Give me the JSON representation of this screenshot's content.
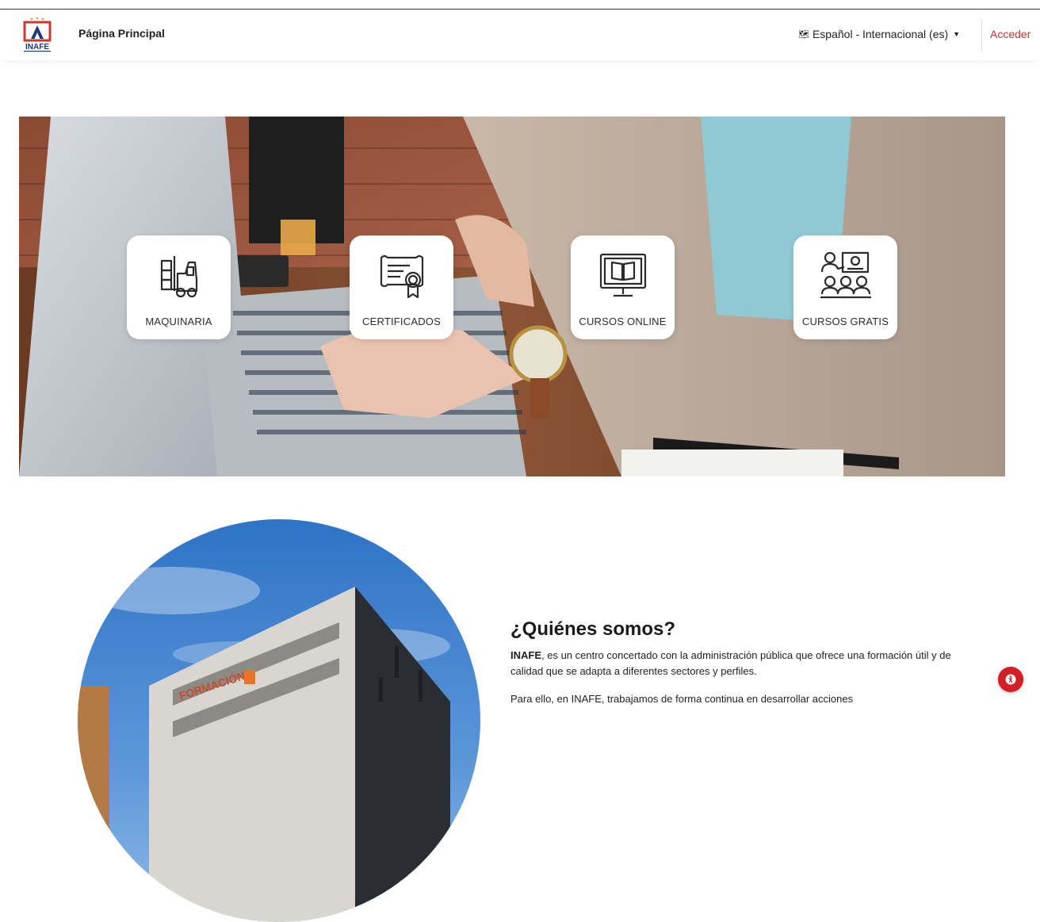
{
  "header": {
    "logo_text": "INAFE",
    "brand": "Página Principal",
    "language": "Español - Internacional (es)",
    "login": "Acceder"
  },
  "hero": {
    "cards": [
      {
        "label": "MAQUINARIA",
        "icon": "forklift-icon"
      },
      {
        "label": "CERTIFICADOS",
        "icon": "certificate-icon"
      },
      {
        "label": "CURSOS ONLINE",
        "icon": "online-course-icon"
      },
      {
        "label": "CURSOS GRATIS",
        "icon": "classroom-icon"
      }
    ]
  },
  "about": {
    "title": "¿Quiénes somos?",
    "p1_strong": "INAFE",
    "p1_rest": ", es un centro concertado con la administración pública que ofrece una formación útil y de calidad que se adapta a diferentes sectores y perfiles.",
    "p2": "Para ello, en INAFE, trabajamos de forma continua en desarrollar acciones",
    "building_sign": "FORMACIÓN"
  },
  "colors": {
    "accent": "#d0352f",
    "a11y": "#d41f26"
  }
}
